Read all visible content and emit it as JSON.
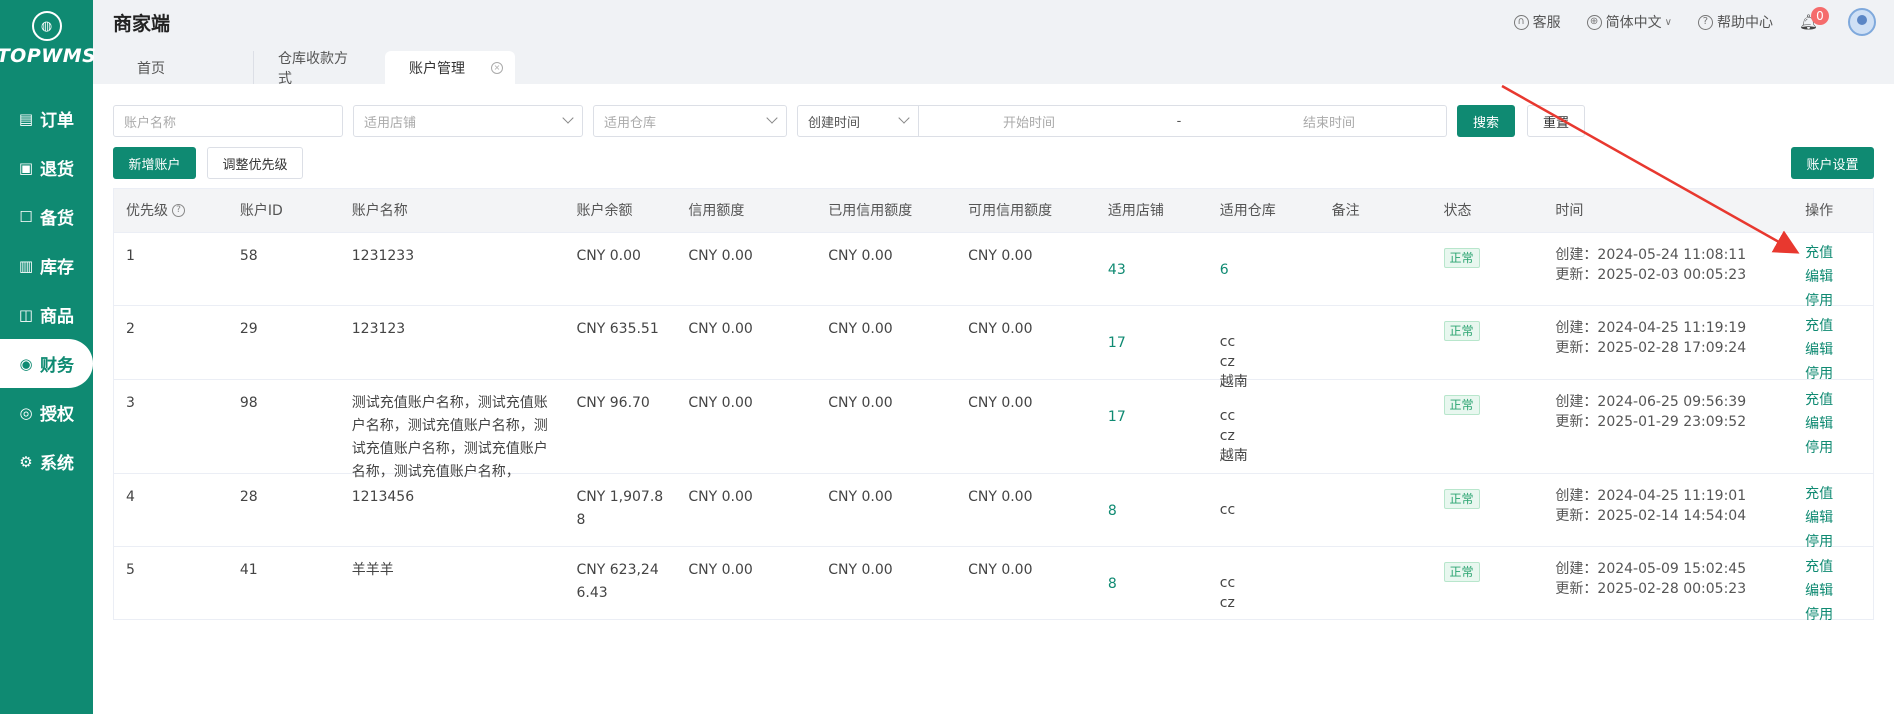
{
  "sidebar": {
    "logo_text": "TOPWMS",
    "items": [
      {
        "label": "订单",
        "icon": "order-icon",
        "glyph": "▤"
      },
      {
        "label": "退货",
        "icon": "return-icon",
        "glyph": "▣"
      },
      {
        "label": "备货",
        "icon": "stock-prep-icon",
        "glyph": "☐"
      },
      {
        "label": "库存",
        "icon": "inventory-icon",
        "glyph": "▥"
      },
      {
        "label": "商品",
        "icon": "product-icon",
        "glyph": "◫"
      },
      {
        "label": "财务",
        "icon": "finance-icon",
        "glyph": "◉"
      },
      {
        "label": "授权",
        "icon": "auth-icon",
        "glyph": "◎"
      },
      {
        "label": "系统",
        "icon": "system-icon",
        "glyph": "⚙"
      }
    ]
  },
  "header": {
    "title": "商家端",
    "service": "客服",
    "language": "简体中文",
    "help": "帮助中心",
    "notifications": "0"
  },
  "tabs": [
    "首页",
    "仓库收款方式",
    "账户管理"
  ],
  "filters": {
    "account_name_placeholder": "账户名称",
    "store_placeholder": "适用店铺",
    "warehouse_placeholder": "适用仓库",
    "time_type": "创建时间",
    "start_placeholder": "开始时间",
    "range_sep": "-",
    "end_placeholder": "结束时间",
    "search": "搜索",
    "reset": "重置"
  },
  "actions": {
    "add_account": "新增账户",
    "adjust_priority": "调整优先级",
    "account_settings": "账户设置"
  },
  "table": {
    "columns": [
      "优先级",
      "账户ID",
      "账户名称",
      "账户余额",
      "信用额度",
      "已用信用额度",
      "可用信用额度",
      "适用店铺",
      "适用仓库",
      "备注",
      "状态",
      "时间",
      "操作"
    ],
    "rows": [
      {
        "priority": "1",
        "id": "58",
        "name": "1231233",
        "balance": "CNY 0.00",
        "credit": "CNY 0.00",
        "used_credit": "CNY 0.00",
        "avail_credit": "CNY 0.00",
        "stores": "43",
        "warehouses": "6",
        "remark": "",
        "status": "正常",
        "created": "创建：2024-05-24 11:08:11",
        "updated": "更新：2025-02-03 00:05:23",
        "ops": [
          "充值",
          "编辑",
          "停用"
        ]
      },
      {
        "priority": "2",
        "id": "29",
        "name": "123123",
        "balance": "CNY 635.51",
        "credit": "CNY 0.00",
        "used_credit": "CNY 0.00",
        "avail_credit": "CNY 0.00",
        "stores": "17",
        "warehouses": "cc\nсz\n越南",
        "remark": "",
        "status": "正常",
        "created": "创建：2024-04-25 11:19:19",
        "updated": "更新：2025-02-28 17:09:24",
        "ops": [
          "充值",
          "编辑",
          "停用"
        ]
      },
      {
        "priority": "3",
        "id": "98",
        "name": "测试充值账户名称，测试充值账户名称，测试充值账户名称，测试充值账户名称，测试充值账户名称，测试充值账户名称，",
        "balance": "CNY 96.70",
        "credit": "CNY 0.00",
        "used_credit": "CNY 0.00",
        "avail_credit": "CNY 0.00",
        "stores": "17",
        "warehouses": "cc\nсz\n越南",
        "remark": "",
        "status": "正常",
        "created": "创建：2024-06-25 09:56:39",
        "updated": "更新：2025-01-29 23:09:52",
        "ops": [
          "充值",
          "编辑",
          "停用"
        ]
      },
      {
        "priority": "4",
        "id": "28",
        "name": "1213456",
        "balance": "CNY 1,907.88",
        "credit": "CNY 0.00",
        "used_credit": "CNY 0.00",
        "avail_credit": "CNY 0.00",
        "stores": "8",
        "warehouses": "cc",
        "remark": "",
        "status": "正常",
        "created": "创建：2024-04-25 11:19:01",
        "updated": "更新：2025-02-14 14:54:04",
        "ops": [
          "充值",
          "编辑",
          "停用"
        ]
      },
      {
        "priority": "5",
        "id": "41",
        "name": "羊羊羊",
        "balance": "CNY 623,246.43",
        "credit": "CNY 0.00",
        "used_credit": "CNY 0.00",
        "avail_credit": "CNY 0.00",
        "stores": "8",
        "warehouses": "cc\nсz",
        "remark": "",
        "status": "正常",
        "created": "创建：2024-05-09 15:02:45",
        "updated": "更新：2025-02-28 00:05:23",
        "ops": [
          "充值",
          "编辑",
          "停用"
        ]
      }
    ]
  },
  "colors": {
    "brand": "#0f8a72",
    "status_ok": "#2ba471",
    "arrow": "#e8382f"
  }
}
